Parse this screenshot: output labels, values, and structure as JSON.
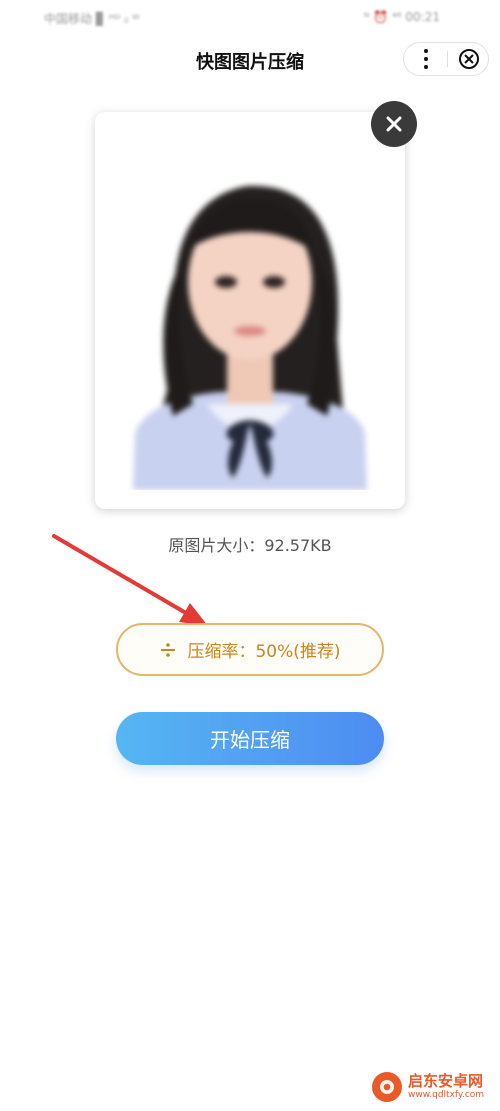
{
  "status_bar": {
    "carrier": "中国移动 ▊ ᴴᴰ ᵢₗ ᵂ",
    "right": "ᴺ ⏰ ⁴⁶ 00:21"
  },
  "header": {
    "title": "快图图片压缩"
  },
  "preview": {
    "photo_alt": "证件照预览"
  },
  "info": {
    "file_size_text": "原图片大小：92.57KB"
  },
  "compression": {
    "ratio_text": "压缩率：50%(推荐)"
  },
  "actions": {
    "start_label": "开始压缩"
  },
  "watermark": {
    "name": "启东安卓网",
    "url": "www.qdltxfy.com"
  },
  "colors": {
    "accent_orange": "#e7b568",
    "button_blue_start": "#56b6f3",
    "button_blue_end": "#4d8cf1",
    "annotation_red": "#e53935"
  }
}
